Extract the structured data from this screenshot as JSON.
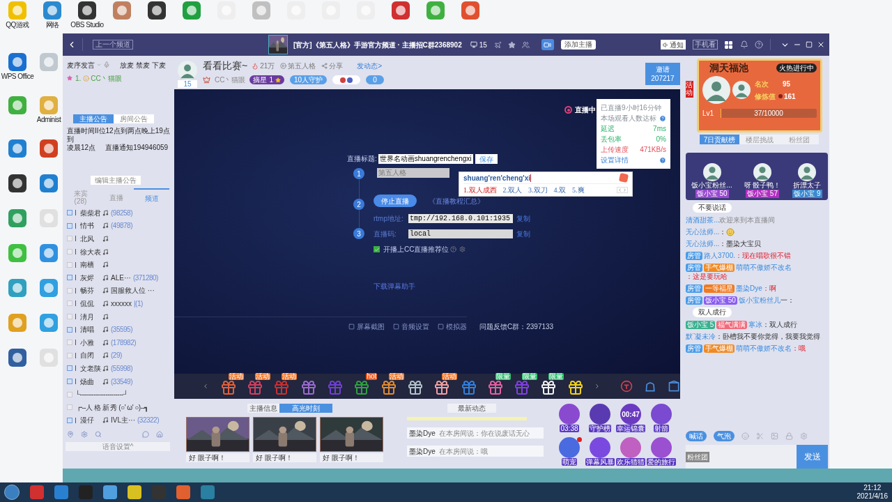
{
  "desktop_icons": [
    {
      "label": "QQ游戏"
    },
    {
      "label": "网络"
    },
    {
      "label": "OBS Studio"
    },
    {
      "label": "WPS Office"
    },
    {
      "label": "Administ"
    }
  ],
  "window": {
    "back_button": "上一个频道",
    "title": "[官方]《第五人格》手游官方频道 · 主播招C群2368902",
    "room_count": "15",
    "add_host_button": "添加主播",
    "notice_button": "通知",
    "mobile_button": "手机看"
  },
  "left_panel": {
    "mic_mode": "麦序发言",
    "mic_controls": "放麦 禁麦 下麦",
    "queue": [
      {
        "index": "1.",
        "name": "CC丶猫眼"
      }
    ],
    "notice_tabs": [
      {
        "label": "主播公告",
        "selected": true
      },
      {
        "label": "房间公告",
        "selected": false
      }
    ],
    "notice_lines": [
      "直播时间II位12点到两点晚上19点到",
      "凌晨12点",
      "直播通知194946059"
    ],
    "edit_notice_button": "编辑主播公告",
    "list_tabs": [
      {
        "label": "来宾",
        "count": "(28)",
        "selected": false
      },
      {
        "label": "直播",
        "selected": false
      },
      {
        "label": "频道",
        "selected": true
      }
    ],
    "members": [
      {
        "name": "柴柴君",
        "checked": true,
        "count": "(98258)"
      },
      {
        "name": "情书",
        "checked": true,
        "count": "(49878)"
      },
      {
        "name": "北风",
        "checked": false
      },
      {
        "name": "徐大表",
        "checked": false
      },
      {
        "name": "南樯",
        "checked": false
      },
      {
        "name": "灰烬",
        "checked": true,
        "note": "ALE···",
        "count": "(371280)"
      },
      {
        "name": "畅芬",
        "checked": false,
        "note": "国服救人位 ···"
      },
      {
        "name": "侃侃",
        "checked": false,
        "note": "xxxxxx",
        "count": "|(1)"
      },
      {
        "name": "淸月",
        "checked": false
      },
      {
        "name": "清唱",
        "checked": true,
        "count": "(35595)"
      },
      {
        "name": "小雅",
        "checked": false,
        "count": "(178982)"
      },
      {
        "name": "自闭",
        "checked": false,
        "count": "(29)"
      },
      {
        "name": "文老陕",
        "checked": true,
        "count": "(55998)"
      },
      {
        "name": "炀曲",
        "checked": true,
        "count": "(33549)"
      },
      {
        "kind": "line",
        "text": "└----------------------┘",
        "checked": false
      },
      {
        "kind": "line",
        "text": "┏--人 格 新 秀 (○' ω' ○)--┓",
        "checked": false
      },
      {
        "name": "漫仔",
        "checked": true,
        "note": "IVL主···",
        "count": "(32322)"
      }
    ],
    "voice_settings": "语音设置^"
  },
  "header": {
    "room_id": "15",
    "title": "看看比赛~",
    "heat": "21万",
    "game": "第五人格",
    "share": "分享",
    "post": "发动态>",
    "host": "CC丶猫眼",
    "star_badge": "摘星",
    "star_count": "1",
    "guard_badge": "10人守护",
    "fans_count": "0",
    "invite_label": "邀请",
    "invite_count": "207217"
  },
  "video": {
    "live_label": "直播中",
    "stats": [
      {
        "label": "已直播9小时16分钟",
        "kind": "info"
      },
      {
        "label": "本场观看人数达标",
        "kind": "info",
        "help": true
      },
      {
        "label": "延迟",
        "value": "7ms",
        "kind": "good"
      },
      {
        "label": "丢包率",
        "value": "0%",
        "kind": "good"
      },
      {
        "label": "上传速度",
        "value": "471KB/s",
        "kind": "bad"
      },
      {
        "label": "设置详情",
        "kind": "link",
        "help": true
      }
    ],
    "title_label": "直播标题:",
    "title_value": "世界名动画shuangrenchengxi",
    "save": "保存",
    "steps": [
      "1",
      "2",
      "3"
    ],
    "game_value": "第五人格",
    "stop_button": "停止直播",
    "tutorial_link": "《直播教程汇总》",
    "rtmp_label": "rtmp地址:",
    "rtmp_value": "tmp://192.168.0.101:1935",
    "rtmp_copy": "复制",
    "code_label": "直播码:",
    "code_value": "local",
    "code_copy": "复制",
    "recommend": {
      "label": "开播上CC直播推荐位",
      "checked": true
    },
    "download_link": "下载弹幕助手",
    "tools": [
      "屏幕截图",
      "音频设置",
      "模拟器"
    ],
    "feedback": "问题反馈C群：2397133",
    "ime": {
      "input": "shuang'ren'cheng'xi",
      "candidates": [
        {
          "text": "1.双人成西",
          "selected": true
        },
        {
          "text": "2.双人",
          "selected": false
        },
        {
          "text": "3.双刀",
          "selected": false
        },
        {
          "text": "4.双",
          "selected": false
        },
        {
          "text": "5.爽",
          "selected": false
        }
      ]
    }
  },
  "gifts": [
    {
      "kind": "lantern",
      "tag": "活动"
    },
    {
      "kind": "fish",
      "tag": "活动"
    },
    {
      "kind": "banner",
      "tag": "活动"
    },
    {
      "kind": "wizard"
    },
    {
      "kind": "rocket"
    },
    {
      "kind": "frog",
      "tag": "hot"
    },
    {
      "kind": "fox",
      "tag": "活动"
    },
    {
      "kind": "web"
    },
    {
      "kind": "shell",
      "tag": "活动"
    },
    {
      "kind": "ticket"
    },
    {
      "kind": "candy",
      "tag": "限量"
    },
    {
      "kind": "gem",
      "tag": "限量"
    },
    {
      "kind": "bun",
      "tag": "限量"
    },
    {
      "kind": "cube"
    }
  ],
  "bottom": {
    "info_tabs": [
      {
        "label": "主播信息",
        "selected": false
      },
      {
        "label": "高光时刻",
        "selected": true
      }
    ],
    "highlights": [
      "好 眼子啊！",
      "好 眼子啊！",
      "好 眼子啊！"
    ],
    "news_tab": "最新动态",
    "news": [
      {
        "name": "墨染Dye",
        "text": "在本房间说：你在说废话无心"
      },
      {
        "name": "墨染Dye",
        "text": "在本房间说：哦"
      }
    ],
    "activities": [
      {
        "label": "03:38"
      },
      {
        "label": "守护榜"
      },
      {
        "label": "幸运锦囊",
        "timer": "00:47"
      },
      {
        "label": "射箭"
      },
      {
        "label": "萌宠",
        "dot": true
      },
      {
        "label": "弹幕风暴"
      },
      {
        "label": "欢乐猜猜"
      },
      {
        "label": "爱的旅行"
      }
    ]
  },
  "right_panel": {
    "side_tab": "活动",
    "pool": {
      "title": "洞天福池",
      "status": "火热进行中",
      "rank_label": "名次",
      "rank": "95",
      "score_label": "修炼值",
      "score": "161",
      "level_label": "Lv1",
      "progress": "37/10000",
      "level": 0.0037
    },
    "rank_tabs": [
      {
        "label": "7日贡献榜",
        "selected": true
      },
      {
        "label": "楼层挑战",
        "selected": false
      },
      {
        "label": "粉丝团",
        "selected": false
      }
    ],
    "top_fans": [
      {
        "name": "饭小宝粉丝...",
        "badge": "饭小宝",
        "lv": "50",
        "color": "#9a4ad0"
      },
      {
        "name": "呀 骰子鸭！",
        "badge": "饭小宝",
        "lv": "57",
        "color": "#b030c0"
      },
      {
        "name": "折漂太子",
        "badge": "饭小宝",
        "lv": "9",
        "color": "#3a8ad0"
      }
    ],
    "chat": [
      {
        "kind": "banner",
        "text": "不要说话"
      },
      {
        "kind": "system",
        "name": "清酒甜茶...",
        "text": "欢迎来到本直播间",
        "alert": false
      },
      {
        "kind": "emoji",
        "name": "无心法师...",
        "text": "：",
        "alert": false
      },
      {
        "kind": "message",
        "name": "无心法师...",
        "text": "：墨染大宝贝",
        "alert": false
      },
      {
        "kind": "message",
        "badges": [
          {
            "text": "房管",
            "color": "#4a9be8"
          }
        ],
        "name": "路人3700.",
        "text": "：现在唱歌很不错",
        "alert": true
      },
      {
        "kind": "message",
        "badges": [
          {
            "text": "房管",
            "color": "#4a9be8"
          },
          {
            "text": "手气爆棚",
            "color": "#f08a24"
          }
        ],
        "name": "萌萌不傲娇不改名",
        "text": "：这是要玩哈",
        "alert": true
      },
      {
        "kind": "message",
        "badges": [
          {
            "text": "房管",
            "color": "#4a9be8"
          },
          {
            "text": "一等福星",
            "color": "#f07a20"
          }
        ],
        "name": "墨染Dye",
        "text": "：啊",
        "alert": true
      },
      {
        "kind": "message",
        "badges": [
          {
            "text": "房管",
            "color": "#4a9be8"
          },
          {
            "text": "饭小宝 50",
            "color": "#8a5cf0"
          }
        ],
        "name": "饭小宝粉丝儿",
        "text": "一：",
        "alert": false
      },
      {
        "kind": "banner",
        "text": "双人成行"
      },
      {
        "kind": "message",
        "badges": [
          {
            "text": "饭小宝 5",
            "color": "#3bb08f"
          },
          {
            "text": "福气满满",
            "color": "#f06a7a"
          }
        ],
        "name": "寒冰",
        "text": "：双人成行",
        "alert": false
      },
      {
        "kind": "message",
        "name": "默¨凝未冷",
        "text": "：卧槽我不要你觉得，我要我觉得",
        "alert": false
      },
      {
        "kind": "message",
        "badges": [
          {
            "text": "房管",
            "color": "#4a9be8"
          },
          {
            "text": "手气爆棚",
            "color": "#f08a24"
          }
        ],
        "name": "萌萌不傲娇不改名",
        "text": "：哦",
        "alert": true
      }
    ],
    "shout": "喊话",
    "bubble": "气泡",
    "fan_club": "粉丝团",
    "send": "发送"
  },
  "taskbar": {
    "time": "21:12",
    "date": "2021/4/16"
  }
}
